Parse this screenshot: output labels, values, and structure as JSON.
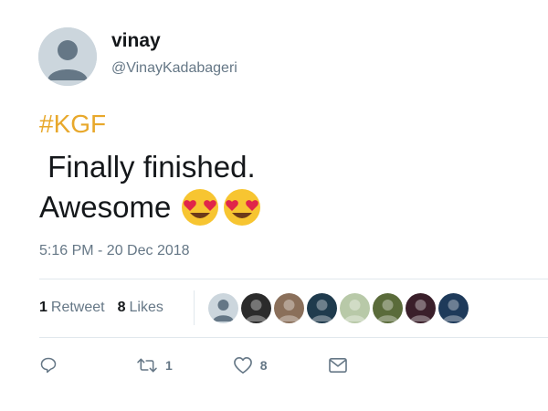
{
  "user": {
    "display_name": "vinay",
    "handle": "@VinayKadabageri"
  },
  "tweet": {
    "hashtag": "#KGF",
    "line1": " Finally finished.",
    "line2": "Awesome",
    "emojis": [
      "heart-eyes-emoji",
      "heart-eyes-emoji"
    ],
    "timestamp": "5:16 PM - 20 Dec 2018"
  },
  "stats": {
    "retweet_count": "1",
    "retweet_label": "Retweet",
    "like_count": "8",
    "like_label": "Likes"
  },
  "likers": [
    {
      "color": "#ccd6dd"
    },
    {
      "color": "#2b2b2b"
    },
    {
      "color": "#8a6f5a"
    },
    {
      "color": "#1f3b4d"
    },
    {
      "color": "#b8c9a8"
    },
    {
      "color": "#5a6b3a"
    },
    {
      "color": "#3a1f2a"
    },
    {
      "color": "#1e3a5a"
    }
  ],
  "actions": {
    "reply_icon": "reply-icon",
    "retweet_icon": "retweet-icon",
    "retweet_count": "1",
    "like_icon": "heart-icon",
    "like_count": "8",
    "dm_icon": "envelope-icon"
  },
  "colors": {
    "hashtag": "#e8a82b",
    "muted": "#657786",
    "divider": "#e1e8ed"
  }
}
